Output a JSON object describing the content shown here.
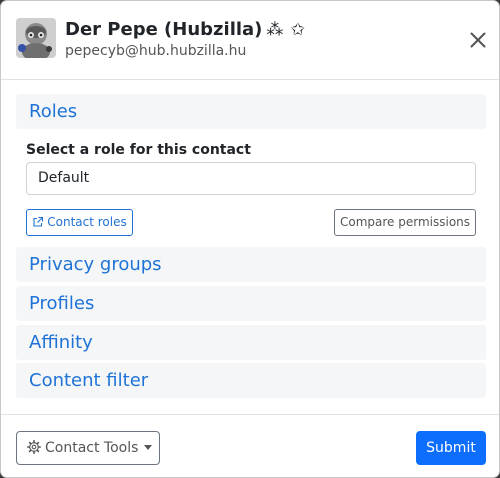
{
  "header": {
    "name": "Der Pepe (Hubzilla)",
    "name_glyphs": "⁂ ✩",
    "handle": "pepecyb@hub.hubzilla.hu",
    "close_icon": "close-icon"
  },
  "roles": {
    "title": "Roles",
    "select_label": "Select a role for this contact",
    "selected_role": "Default",
    "contact_roles_label": "Contact roles",
    "compare_label": "Compare permissions"
  },
  "sections": {
    "privacy_groups": "Privacy groups",
    "profiles": "Profiles",
    "affinity": "Affinity",
    "content_filter": "Content filter"
  },
  "footer": {
    "tools_label": "Contact Tools",
    "submit_label": "Submit"
  },
  "colors": {
    "accent": "#1f73d6",
    "primary_button": "#0d6efd",
    "section_background": "#f4f6f8"
  }
}
